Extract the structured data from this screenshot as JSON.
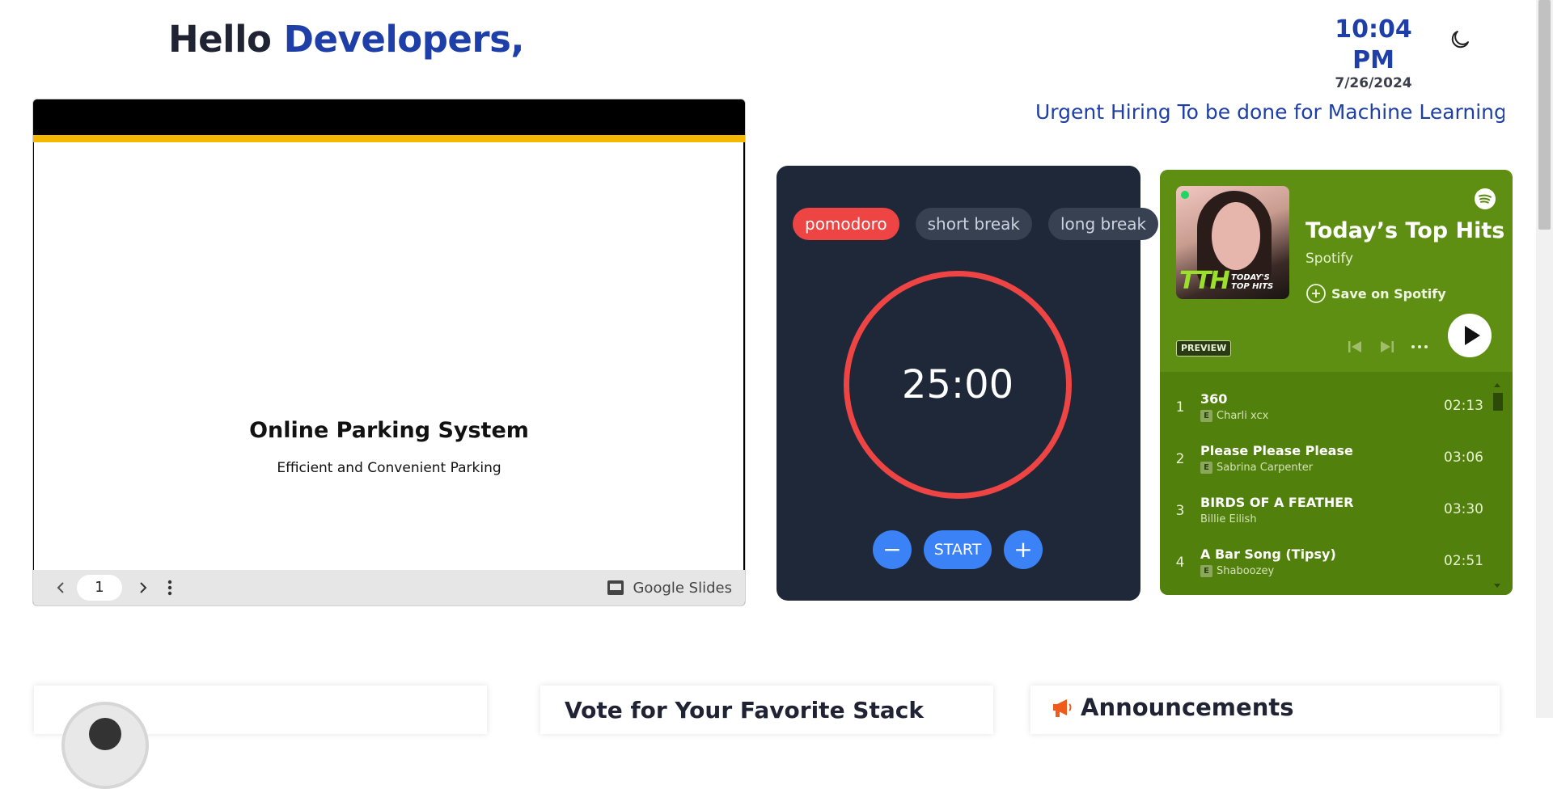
{
  "header": {
    "greeting_prefix": "Hello",
    "greeting_name": "Developers,",
    "time": "10:04 PM",
    "date": "7/26/2024",
    "theme_toggle_icon": "moon-icon"
  },
  "marquee": {
    "text": "Urgent Hiring To be done for Machine Learning To"
  },
  "slides": {
    "title": "Online Parking System",
    "subtitle": "Efficient and Convenient Parking",
    "page_number": "1",
    "brand_label": "Google Slides",
    "stripe_color": "#f5b800"
  },
  "pomodoro": {
    "modes": [
      {
        "label": "pomodoro",
        "active": true
      },
      {
        "label": "short break",
        "active": false
      },
      {
        "label": "long break",
        "active": false
      }
    ],
    "timer": "25:00",
    "minus_label": "−",
    "start_label": "START",
    "plus_label": "+",
    "accent": "#ee4444",
    "button_color": "#3b82f6"
  },
  "spotify": {
    "playlist_title": "Today’s Top Hits",
    "owner": "Spotify",
    "save_label": "Save on Spotify",
    "preview_label": "PREVIEW",
    "cover_text": "TTH",
    "cover_subtext": "TODAY'S TOP HITS",
    "background": "#5a8a0f",
    "tracks": [
      {
        "num": "1",
        "title": "360",
        "artist": "Charli xcx",
        "explicit": true,
        "duration": "02:13"
      },
      {
        "num": "2",
        "title": "Please Please Please",
        "artist": "Sabrina Carpenter",
        "explicit": true,
        "duration": "03:06"
      },
      {
        "num": "3",
        "title": "BIRDS OF A FEATHER",
        "artist": "Billie Eilish",
        "explicit": false,
        "duration": "03:30"
      },
      {
        "num": "4",
        "title": "A Bar Song (Tipsy)",
        "artist": "Shaboozey",
        "explicit": true,
        "duration": "02:51"
      }
    ],
    "explicit_badge": "E"
  },
  "cards": {
    "vote_title": "Vote for Your Favorite Stack",
    "announcements_title": "Announcements"
  }
}
